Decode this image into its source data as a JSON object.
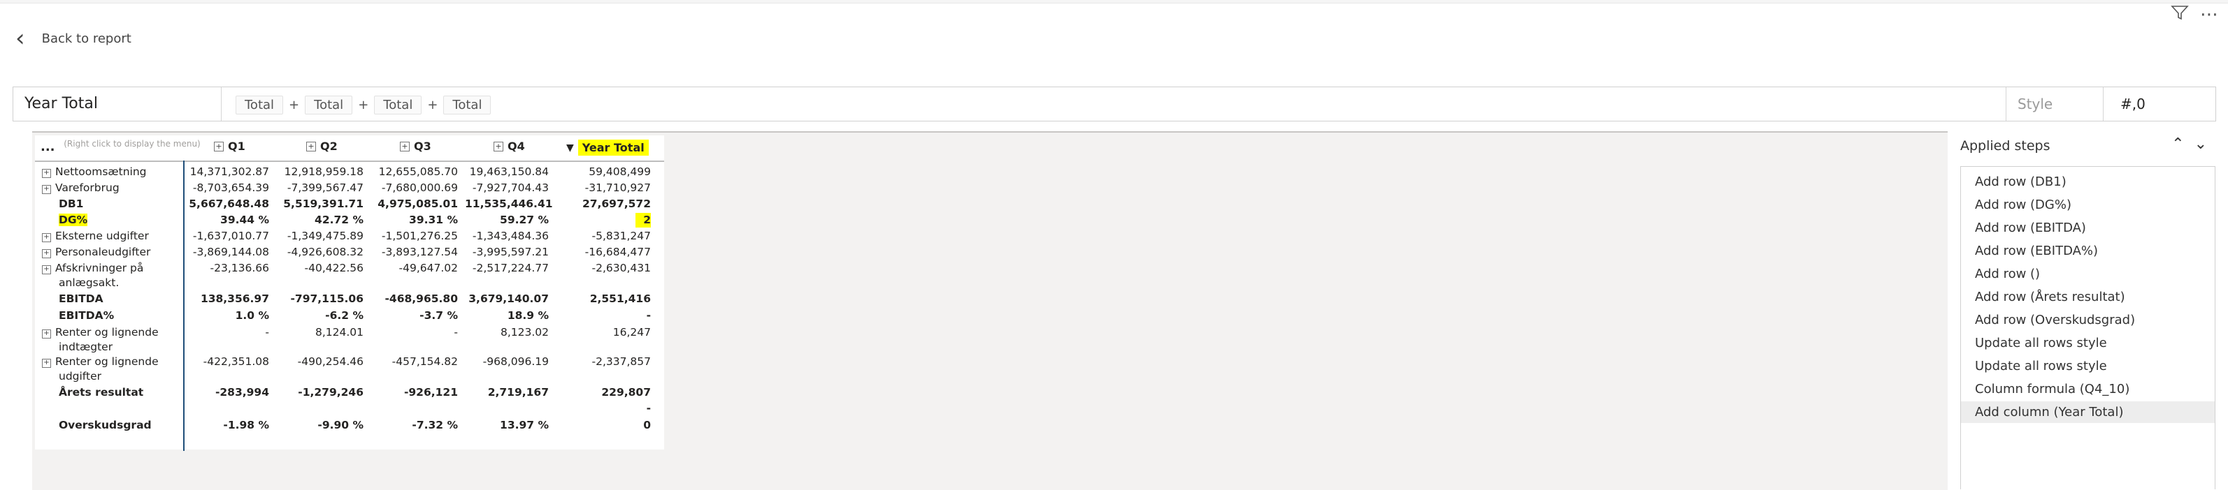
{
  "nav": {
    "back_label": "Back to report",
    "filter_icon": "filter-icon",
    "more_icon": "more-icon"
  },
  "formula": {
    "name": "Year Total",
    "tokens": [
      "Total",
      "Total",
      "Total",
      "Total"
    ],
    "operator": "+",
    "style_label": "Style",
    "style_value": "#,0"
  },
  "table": {
    "menu": "...",
    "hint": "(Right click to display the menu)",
    "columns": [
      "Q1",
      "Q2",
      "Q3",
      "Q4",
      "Year Total"
    ],
    "rows": [
      {
        "label": "Nettoomsætning",
        "expand": true,
        "bold": false,
        "values": [
          "14,371,302.87",
          "12,918,959.18",
          "12,655,085.70",
          "19,463,150.84",
          "59,408,499"
        ]
      },
      {
        "label": "Vareforbrug",
        "expand": true,
        "bold": false,
        "values": [
          "-8,703,654.39",
          "-7,399,567.47",
          "-7,680,000.69",
          "-7,927,704.43",
          "-31,710,927"
        ]
      },
      {
        "label": "DB1",
        "expand": false,
        "bold": true,
        "values": [
          "5,667,648.48",
          "5,519,391.71",
          "4,975,085.01",
          "11,535,446.41",
          "27,697,572"
        ]
      },
      {
        "label": "DG%",
        "expand": false,
        "bold": true,
        "values": [
          "39.44 %",
          "42.72 %",
          "39.31 %",
          "59.27 %",
          "2"
        ]
      },
      {
        "label": "Eksterne udgifter",
        "expand": true,
        "bold": false,
        "values": [
          "-1,637,010.77",
          "-1,349,475.89",
          "-1,501,276.25",
          "-1,343,484.36",
          "-5,831,247"
        ]
      },
      {
        "label": "Personaleudgifter",
        "expand": true,
        "bold": false,
        "values": [
          "-3,869,144.08",
          "-4,926,608.32",
          "-3,893,127.54",
          "-3,995,597.21",
          "-16,684,477"
        ]
      },
      {
        "label": "Afskrivninger på",
        "label2": "anlægsakt.",
        "expand": true,
        "bold": false,
        "values": [
          "-23,136.66",
          "-40,422.56",
          "-49,647.02",
          "-2,517,224.77",
          "-2,630,431"
        ]
      },
      {
        "label": "EBITDA",
        "expand": false,
        "bold": true,
        "values": [
          "138,356.97",
          "-797,115.06",
          "-468,965.80",
          "3,679,140.07",
          "2,551,416"
        ]
      },
      {
        "label": "EBITDA%",
        "expand": false,
        "bold": true,
        "values": [
          "1.0 %",
          "-6.2 %",
          "-3.7 %",
          "18.9 %",
          "-"
        ]
      },
      {
        "label": "Renter og lignende",
        "label2": "indtægter",
        "expand": true,
        "bold": false,
        "values": [
          "-",
          "8,124.01",
          "-",
          "8,123.02",
          "16,247"
        ]
      },
      {
        "label": "Renter og lignende",
        "label2": "udgifter",
        "expand": true,
        "bold": false,
        "values": [
          "-422,351.08",
          "-490,254.46",
          "-457,154.82",
          "-968,096.19",
          "-2,337,857"
        ]
      },
      {
        "label": "Årets resultat",
        "expand": false,
        "bold": true,
        "values": [
          "-283,994",
          "-1,279,246",
          "-926,121",
          "2,719,167",
          "229,807"
        ]
      },
      {
        "label": "",
        "expand": false,
        "bold": true,
        "values": [
          "",
          "",
          "",
          "",
          "-"
        ]
      },
      {
        "label": "Overskudsgrad",
        "expand": false,
        "bold": true,
        "values": [
          "-1.98 %",
          "-9.90 %",
          "-7.32 %",
          "13.97 %",
          "0"
        ]
      }
    ]
  },
  "steps": {
    "title": "Applied steps",
    "items": [
      "Add row (DB1)",
      "Add row (DG%)",
      "Add row (EBITDA)",
      "Add row (EBITDA%)",
      "Add row ()",
      "Add row (Årets resultat)",
      "Add row (Overskudsgrad)",
      "Update all rows style",
      "Update all rows style",
      "Column formula (Q4_10)",
      "Add column (Year Total)"
    ],
    "selected_index": 10
  },
  "colors": {
    "highlight": "#ffff00",
    "divider": "#1f4e79",
    "canvas": "#f3f2f1"
  }
}
